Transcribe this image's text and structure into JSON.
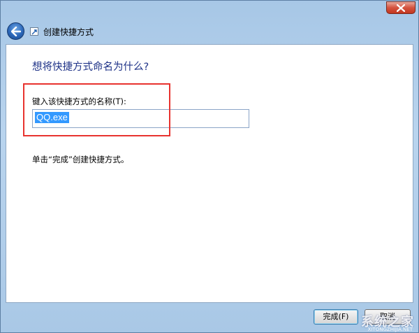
{
  "window": {
    "title": "创建快捷方式"
  },
  "content": {
    "heading": "想将快捷方式命名为什么?",
    "field_label": "键入该快捷方式的名称(T):",
    "name_value": "QQ.exe",
    "hint": "单击“完成”创建快捷方式。"
  },
  "footer": {
    "finish_label": "完成(F)",
    "cancel_label": "取消"
  },
  "watermark": {
    "text": "系统之家",
    "url": "XITONGZHIJIA.NET"
  },
  "colors": {
    "heading": "#1e3287",
    "highlight_box": "#e8332f",
    "selection": "#3399ff",
    "close_button": "#d4533f",
    "frame": "#b9d4ee"
  },
  "icons": {
    "back": "back-arrow-icon",
    "close": "close-x-icon",
    "title": "shortcut-icon"
  }
}
